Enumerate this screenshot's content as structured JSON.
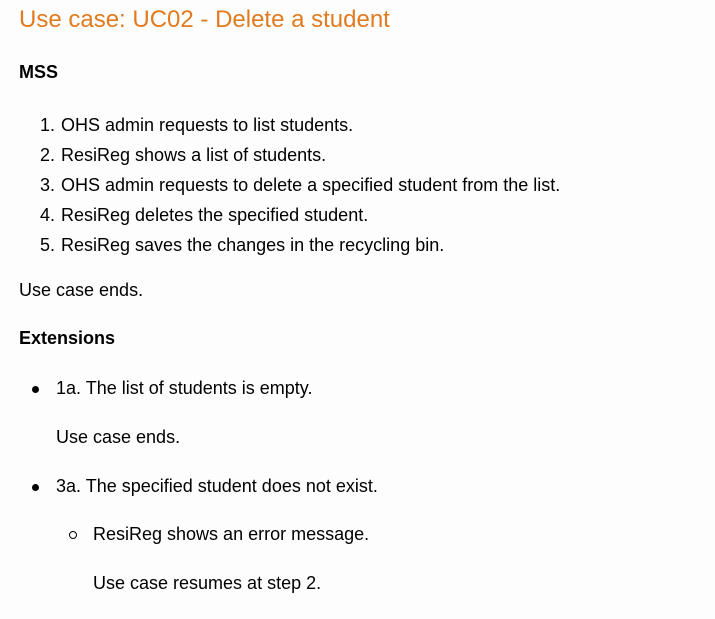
{
  "title": "Use case: UC02 - Delete a student",
  "mss": {
    "heading": "MSS",
    "steps": [
      {
        "num": "1.",
        "text": "OHS admin requests to list students."
      },
      {
        "num": "2.",
        "text": "ResiReg shows a list of students."
      },
      {
        "num": "3.",
        "text": "OHS admin requests to delete a specified student from the list."
      },
      {
        "num": "4.",
        "text": "ResiReg deletes the specified student."
      },
      {
        "num": "5.",
        "text": "ResiReg saves the changes in the recycling bin."
      }
    ],
    "end": "Use case ends."
  },
  "extensions": {
    "heading": "Extensions",
    "items": [
      {
        "text": "1a. The list of students is empty.",
        "note": "Use case ends."
      },
      {
        "text": "3a. The specified student does not exist.",
        "sub": {
          "text": "ResiReg shows an error message.",
          "note": "Use case resumes at step 2."
        }
      }
    ]
  },
  "colors": {
    "title": "#e07b1f"
  }
}
